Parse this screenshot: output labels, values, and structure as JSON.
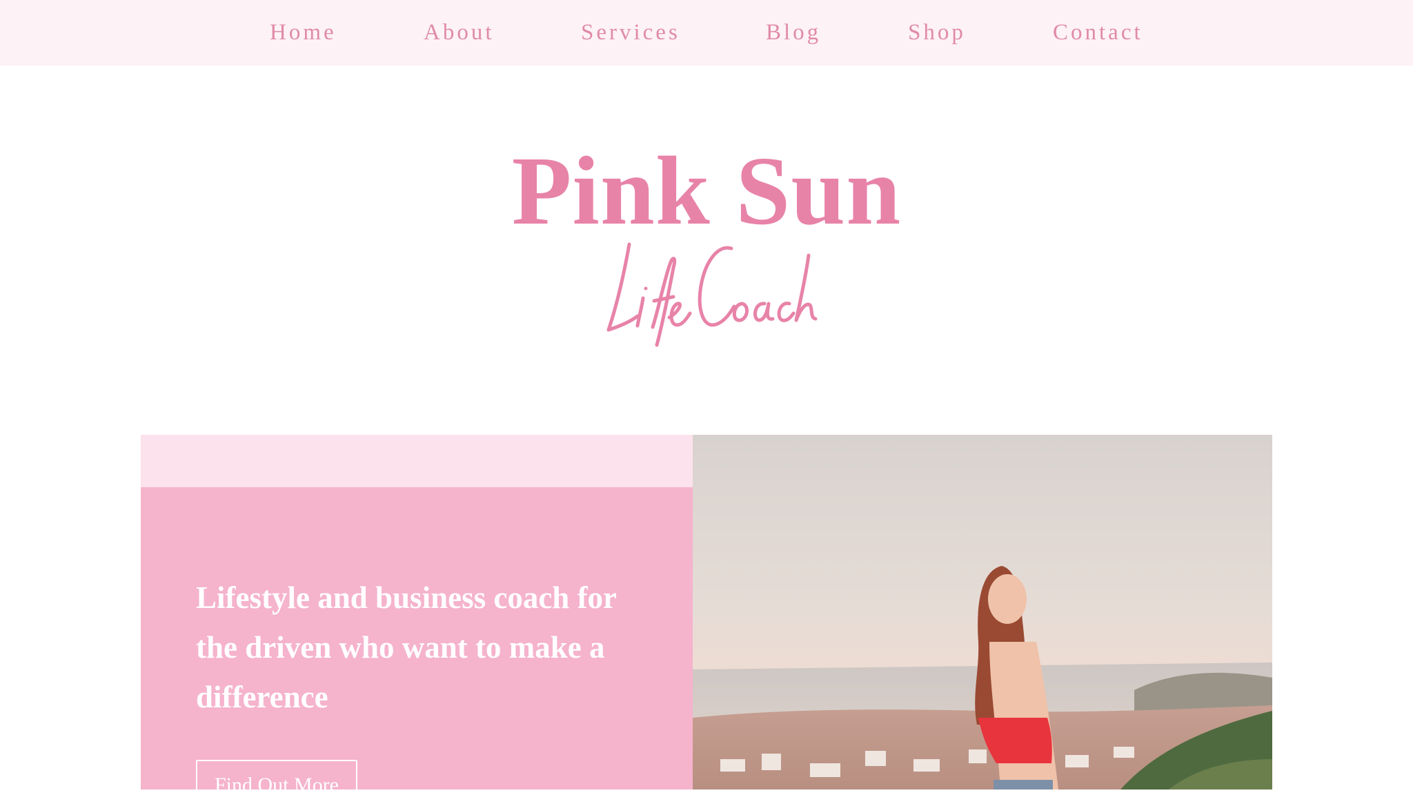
{
  "nav": {
    "items": [
      {
        "label": "Home"
      },
      {
        "label": "About"
      },
      {
        "label": "Services"
      },
      {
        "label": "Blog"
      },
      {
        "label": "Shop"
      },
      {
        "label": "Contact"
      }
    ]
  },
  "brand": {
    "title": "Pink Sun",
    "subtitle": "Life Coach"
  },
  "hero": {
    "tagline": "Lifestyle and business coach for the driven who want to make a difference",
    "cta_label": "Find Out More"
  },
  "colors": {
    "accent": "#e883a8",
    "nav_bg": "#fdf2f6",
    "panel_light": "#fce2ec",
    "panel": "#f5b3cc"
  }
}
